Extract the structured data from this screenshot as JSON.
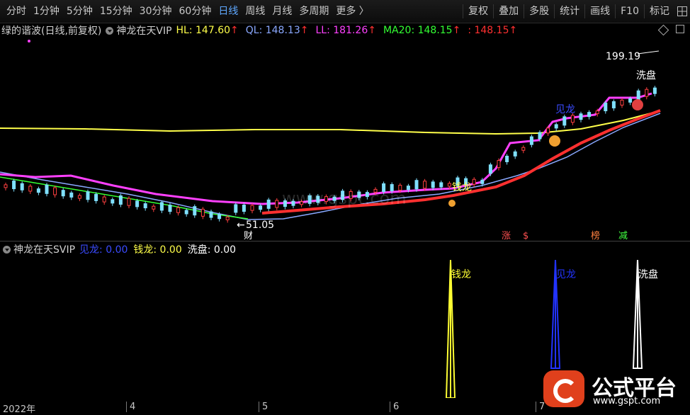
{
  "toolbar": {
    "periods": [
      "分时",
      "1分钟",
      "5分钟",
      "15分钟",
      "30分钟",
      "60分钟",
      "日线",
      "周线",
      "月线",
      "多周期",
      "更多 〉"
    ],
    "active_period": "日线",
    "right": [
      "复权",
      "叠加",
      "多股",
      "统计",
      "画线",
      "F10",
      "标记"
    ],
    "grid_icon": "grid-icon"
  },
  "main_header": {
    "stock": "绿的谐波(日线,前复权)",
    "indicator": "神龙在天VIP",
    "items": [
      {
        "label": "HL: 147.60",
        "arrow": "↑",
        "color": "#ffff4a"
      },
      {
        "label": "QL: 148.13",
        "arrow": "↑",
        "color": "#8aa8ff"
      },
      {
        "label": "LL: 181.26",
        "arrow": "↑",
        "color": "#ff40ff"
      },
      {
        "label": "MA20: 148.15",
        "arrow": "↑",
        "color": "#33ff33"
      },
      {
        "label": ": 148.15",
        "arrow": "↑",
        "color": "#ff3030"
      }
    ]
  },
  "sub_header": {
    "indicator": "神龙在天SVIP",
    "items": [
      {
        "label": "见龙: 0.00",
        "color": "#3a4bff"
      },
      {
        "label": "钱龙: 0.00",
        "color": "#ffff4a"
      },
      {
        "label": "洗盘: 0.00",
        "color": "#ffffff"
      }
    ]
  },
  "annotations": {
    "high_price": "199.19",
    "low_price": "51.05",
    "xipan": "洗盘",
    "jianlong": "见龙",
    "qianlong": "钱龙",
    "cai": "财",
    "zhang": "涨",
    "dollar": "$",
    "bang": "榜",
    "jian": "减"
  },
  "signals": [
    {
      "label": "钱龙",
      "color": "#ffff33"
    },
    {
      "label": "见龙",
      "color": "#2233ff"
    },
    {
      "label": "洗盘",
      "color": "#ffffff"
    }
  ],
  "dates": [
    "2022年",
    "4",
    "5",
    "6",
    "7"
  ],
  "watermark": "www.gspt.com",
  "logo": {
    "name": "公式平台",
    "url": "www.gspt.com"
  },
  "chart_data": {
    "type": "candlestick",
    "y_axis": "price, 前复权",
    "marked_high": 199.19,
    "marked_low": 51.05,
    "series": [
      {
        "name": "HL",
        "color": "#ffff4a",
        "last": 147.6
      },
      {
        "name": "QL",
        "color": "#8aa8ff",
        "last": 148.13
      },
      {
        "name": "LL",
        "color": "#ff40ff",
        "last": 181.26
      },
      {
        "name": "MA20",
        "color": "#33ff33",
        "last": 148.15
      },
      {
        "name": "",
        "color": "#ff3030",
        "last": 148.15
      }
    ],
    "lower_panel": {
      "series": [
        {
          "name": "见龙",
          "value": 0.0
        },
        {
          "name": "钱龙",
          "value": 0.0
        },
        {
          "name": "洗盘",
          "value": 0.0
        }
      ]
    }
  }
}
